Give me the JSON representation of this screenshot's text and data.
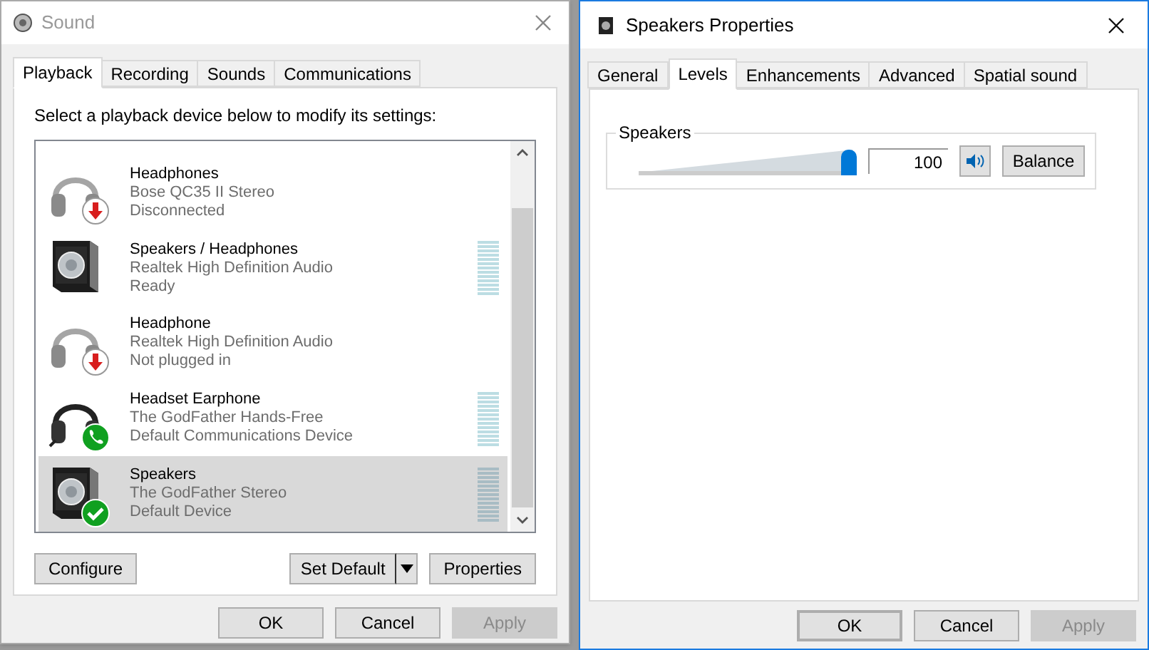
{
  "sound_window": {
    "title": "Sound",
    "tabs": [
      {
        "label": "Playback",
        "selected": true
      },
      {
        "label": "Recording",
        "selected": false
      },
      {
        "label": "Sounds",
        "selected": false
      },
      {
        "label": "Communications",
        "selected": false
      }
    ],
    "instruction": "Select a playback device below to modify its settings:",
    "devices": [
      {
        "name": "Headphones",
        "driver": "Bose QC35 II Stereo",
        "status": "Disconnected",
        "kind": "unplugged",
        "meter": false,
        "selected": false
      },
      {
        "name": "Speakers / Headphones",
        "driver": "Realtek High Definition Audio",
        "status": "Ready",
        "kind": "speaker",
        "meter": true,
        "selected": false
      },
      {
        "name": "Headphone",
        "driver": "Realtek High Definition Audio",
        "status": "Not plugged in",
        "kind": "unplugged",
        "meter": false,
        "selected": false
      },
      {
        "name": "Headset Earphone",
        "driver": "The GodFather Hands-Free",
        "status": "Default Communications Device",
        "kind": "comms",
        "meter": true,
        "selected": false
      },
      {
        "name": "Speakers",
        "driver": "The GodFather Stereo",
        "status": "Default Device",
        "kind": "default",
        "meter": true,
        "selected": true
      }
    ],
    "buttons": {
      "configure": "Configure",
      "set_default": "Set Default",
      "properties": "Properties"
    },
    "footer": [
      {
        "label": "OK",
        "disabled": false
      },
      {
        "label": "Cancel",
        "disabled": false
      },
      {
        "label": "Apply",
        "disabled": true
      }
    ]
  },
  "properties_window": {
    "title": "Speakers Properties",
    "tabs": [
      {
        "label": "General",
        "selected": false
      },
      {
        "label": "Levels",
        "selected": true
      },
      {
        "label": "Enhancements",
        "selected": false
      },
      {
        "label": "Advanced",
        "selected": false
      },
      {
        "label": "Spatial sound",
        "selected": false
      }
    ],
    "group": {
      "label": "Speakers",
      "level": 1,
      "value": "100",
      "balance": "Balance"
    },
    "footer": [
      {
        "label": "OK",
        "disabled": false
      },
      {
        "label": "Cancel",
        "disabled": false
      },
      {
        "label": "Apply",
        "disabled": true
      }
    ]
  }
}
